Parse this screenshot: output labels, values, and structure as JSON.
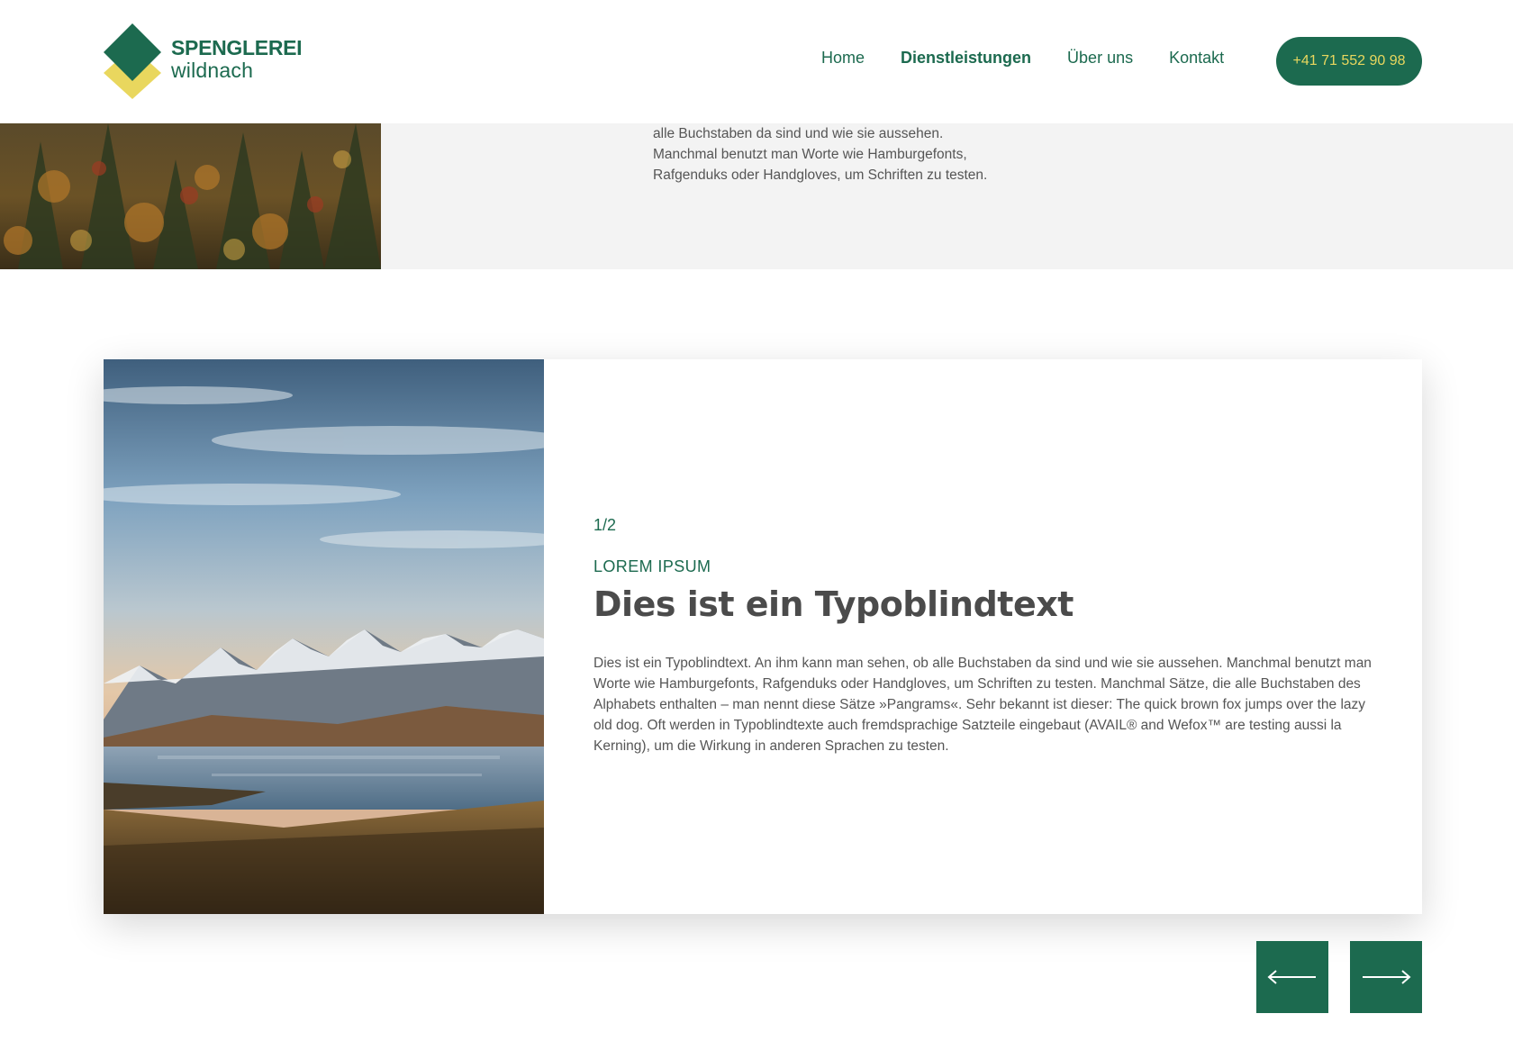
{
  "logo": {
    "top": "SPENGLEREI",
    "bottom": "wildnach"
  },
  "nav": {
    "items": [
      {
        "label": "Home"
      },
      {
        "label": "Dienstleistungen",
        "active": true
      },
      {
        "label": "Über uns"
      },
      {
        "label": "Kontakt"
      }
    ],
    "phone": "+41 71 552 90 98"
  },
  "top_section": {
    "lines": [
      "alle Buchstaben da sind und wie sie aussehen.",
      "Manchmal benutzt man Worte wie Hamburgefonts,",
      "Rafgenduks oder Handgloves, um Schriften zu testen."
    ]
  },
  "slider": {
    "counter": "1/2",
    "eyebrow": "LOREM IPSUM",
    "title": "Dies ist ein Typoblindtext",
    "body": "Dies ist ein Typoblindtext. An ihm kann man sehen, ob alle Buchstaben da sind und wie sie aussehen. Manchmal benutzt man Worte wie Hamburgefonts, Rafgenduks oder Handgloves, um Schriften zu testen. Manchmal Sätze, die alle Buchstaben des Alphabets enthalten – man nennt diese Sätze »Pangrams«. Sehr bekannt ist dieser: The quick brown fox jumps over the lazy old dog. Oft werden in Typoblindtexte auch fremdsprachige Satzteile eingebaut (AVAIL® and Wefox™ are testing aussi la Kerning), um die Wirkung in anderen Sprachen zu testen."
  },
  "icons": {
    "prev": "arrow-left-icon",
    "next": "arrow-right-icon"
  },
  "colors": {
    "brand_green": "#1c6a4f",
    "brand_yellow": "#e9d75e",
    "text_grey": "#555555",
    "section_grey": "#f3f3f3"
  }
}
